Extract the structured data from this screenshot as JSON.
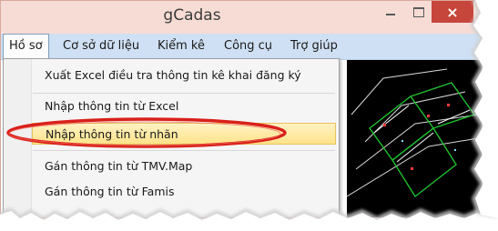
{
  "window": {
    "title": "gCadas",
    "minimize_label": "minimize",
    "maximize_label": "maximize",
    "close_label": "×"
  },
  "menubar": {
    "items": [
      "Hồ sơ",
      "Cơ sở dữ liệu",
      "Kiểm kê",
      "Công cụ",
      "Trợ giúp"
    ]
  },
  "dropdown": {
    "items": [
      "Xuất Excel điều tra thông tin kê khai đăng ký",
      "Nhập thông tin từ Excel",
      "Nhập thông tin từ nhãn",
      "Gán thông tin từ TMV.Map",
      "Gán thông tin từ Famis"
    ],
    "highlighted_item": "Nhập thông tin từ nhãn"
  },
  "colors": {
    "title_bg": "#f6dcd5",
    "menubar_bg": "#cfe0f4",
    "close_bg": "#c7463b",
    "highlight": "#ffe38a",
    "annotation": "#d9201a"
  }
}
